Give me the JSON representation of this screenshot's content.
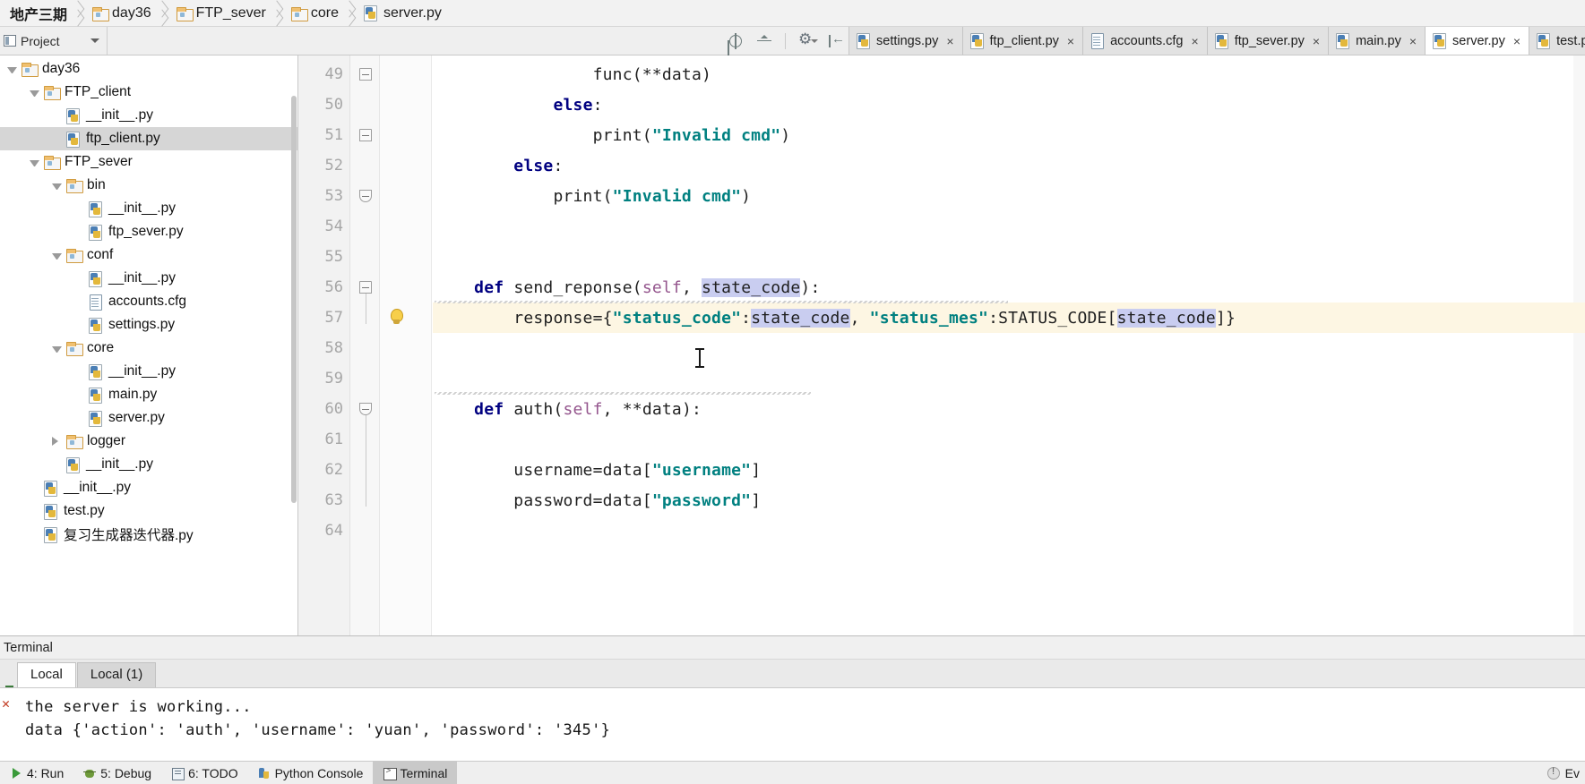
{
  "breadcrumb": [
    {
      "label": "地产三期",
      "icon": "none",
      "cn": true
    },
    {
      "label": "day36",
      "icon": "folder-icon"
    },
    {
      "label": "FTP_sever",
      "icon": "folder-icon"
    },
    {
      "label": "core",
      "icon": "folder-icon"
    },
    {
      "label": "server.py",
      "icon": "python-file-icon"
    }
  ],
  "toolbar": {
    "project_label": "Project",
    "icons": [
      "locate-target-icon",
      "collapse-all-icon",
      "settings-gear-icon",
      "hide-panel-icon"
    ]
  },
  "editor_tabs": [
    {
      "label": "settings.py",
      "icon": "python-file-icon",
      "active": false,
      "close": "×"
    },
    {
      "label": "ftp_client.py",
      "icon": "python-file-icon",
      "active": false,
      "close": "×"
    },
    {
      "label": "accounts.cfg",
      "icon": "config-file-icon",
      "active": false,
      "close": "×"
    },
    {
      "label": "ftp_sever.py",
      "icon": "python-file-icon",
      "active": false,
      "close": "×"
    },
    {
      "label": "main.py",
      "icon": "python-file-icon",
      "active": false,
      "close": "×"
    },
    {
      "label": "server.py",
      "icon": "python-file-icon",
      "active": true,
      "close": "×"
    },
    {
      "label": "test.py",
      "icon": "python-file-icon",
      "active": false,
      "close": "×"
    }
  ],
  "project_tree": [
    {
      "label": "day36",
      "indent": 0,
      "twisty": "open",
      "icon": "folder-icon",
      "selected": false
    },
    {
      "label": "FTP_client",
      "indent": 1,
      "twisty": "open",
      "icon": "folder-icon",
      "selected": false
    },
    {
      "label": "__init__.py",
      "indent": 2,
      "twisty": "none",
      "icon": "python-file-icon",
      "selected": false
    },
    {
      "label": "ftp_client.py",
      "indent": 2,
      "twisty": "none",
      "icon": "python-file-icon",
      "selected": true
    },
    {
      "label": "FTP_sever",
      "indent": 1,
      "twisty": "open",
      "icon": "folder-icon",
      "selected": false
    },
    {
      "label": "bin",
      "indent": 2,
      "twisty": "open",
      "icon": "folder-icon",
      "selected": false
    },
    {
      "label": "__init__.py",
      "indent": 3,
      "twisty": "none",
      "icon": "python-file-icon",
      "selected": false
    },
    {
      "label": "ftp_sever.py",
      "indent": 3,
      "twisty": "none",
      "icon": "python-file-icon",
      "selected": false
    },
    {
      "label": "conf",
      "indent": 2,
      "twisty": "open",
      "icon": "folder-icon",
      "selected": false
    },
    {
      "label": "__init__.py",
      "indent": 3,
      "twisty": "none",
      "icon": "python-file-icon",
      "selected": false
    },
    {
      "label": "accounts.cfg",
      "indent": 3,
      "twisty": "none",
      "icon": "config-file-icon",
      "selected": false
    },
    {
      "label": "settings.py",
      "indent": 3,
      "twisty": "none",
      "icon": "python-file-icon",
      "selected": false
    },
    {
      "label": "core",
      "indent": 2,
      "twisty": "open",
      "icon": "folder-icon",
      "selected": false
    },
    {
      "label": "__init__.py",
      "indent": 3,
      "twisty": "none",
      "icon": "python-file-icon",
      "selected": false
    },
    {
      "label": "main.py",
      "indent": 3,
      "twisty": "none",
      "icon": "python-file-icon",
      "selected": false
    },
    {
      "label": "server.py",
      "indent": 3,
      "twisty": "none",
      "icon": "python-file-icon",
      "selected": false
    },
    {
      "label": "logger",
      "indent": 2,
      "twisty": "closed",
      "icon": "folder-icon",
      "selected": false
    },
    {
      "label": "__init__.py",
      "indent": 2,
      "twisty": "none",
      "icon": "python-file-icon",
      "selected": false
    },
    {
      "label": "__init__.py",
      "indent": 1,
      "twisty": "none",
      "icon": "python-file-icon",
      "selected": false
    },
    {
      "label": "test.py",
      "indent": 1,
      "twisty": "none",
      "icon": "python-file-icon",
      "selected": false
    },
    {
      "label": "复习生成器迭代器.py",
      "indent": 1,
      "twisty": "none",
      "icon": "python-file-icon",
      "selected": false
    }
  ],
  "code": {
    "first_line_number": 49,
    "lines": [
      {
        "n": 49,
        "text": "                func(**data)"
      },
      {
        "n": 50,
        "text": "            else:"
      },
      {
        "n": 51,
        "text": "                print(\"Invalid cmd\")"
      },
      {
        "n": 52,
        "text": "        else:"
      },
      {
        "n": 53,
        "text": "            print(\"Invalid cmd\")"
      },
      {
        "n": 54,
        "text": ""
      },
      {
        "n": 55,
        "text": ""
      },
      {
        "n": 56,
        "text": "    def send_reponse(self, state_code):"
      },
      {
        "n": 57,
        "text": "        response={\"status_code\":state_code, \"status_mes\":STATUS_CODE[state_code]}"
      },
      {
        "n": 58,
        "text": ""
      },
      {
        "n": 59,
        "text": ""
      },
      {
        "n": 60,
        "text": "    def auth(self, **data):"
      },
      {
        "n": 61,
        "text": ""
      },
      {
        "n": 62,
        "text": "        username=data[\"username\"]"
      },
      {
        "n": 63,
        "text": "        password=data[\"password\"]"
      },
      {
        "n": 64,
        "text": ""
      }
    ],
    "highlighted_line": 57,
    "selected_identifier": "state_code"
  },
  "terminal": {
    "title": "Terminal",
    "tabs": [
      {
        "label": "Local",
        "active": true
      },
      {
        "label": "Local (1)",
        "active": false
      }
    ],
    "output": [
      "the server is working...",
      "data {'action': 'auth', 'username': 'yuan', 'password': '345'}"
    ]
  },
  "status_bar": {
    "items": [
      {
        "label": "4: Run",
        "icon": "run-icon",
        "active": false
      },
      {
        "label": "5: Debug",
        "icon": "debug-icon",
        "active": false
      },
      {
        "label": "6: TODO",
        "icon": "todo-icon",
        "active": false
      },
      {
        "label": "Python Console",
        "icon": "python-console-icon",
        "active": false
      },
      {
        "label": "Terminal",
        "icon": "terminal-icon",
        "active": true
      }
    ],
    "right_label": "Ev"
  },
  "colors": {
    "keyword": "#000080",
    "string": "#008080",
    "self_param": "#94558d",
    "line_highlight": "#fdf6e3",
    "selection": "#c9cdf0",
    "selected_row": "#d6d6d6"
  }
}
